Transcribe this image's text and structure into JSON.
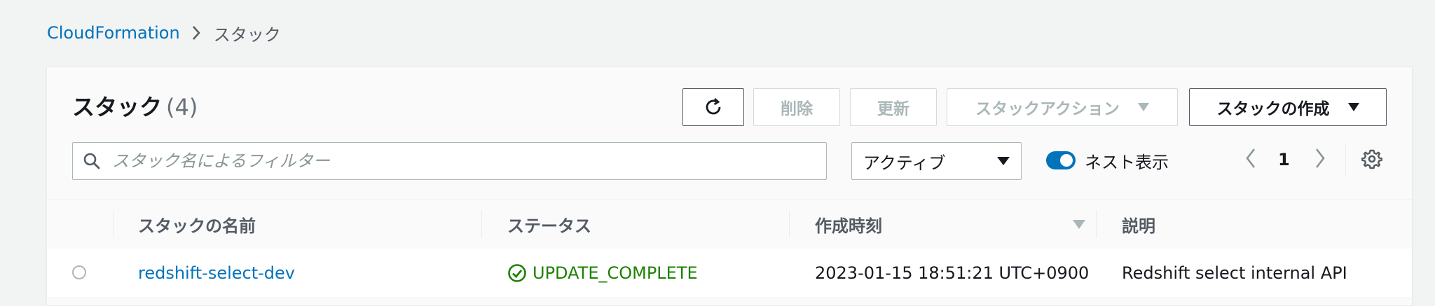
{
  "breadcrumb": {
    "root": "CloudFormation",
    "current": "スタック"
  },
  "panel": {
    "title": "スタック",
    "count": "(4)"
  },
  "toolbar": {
    "delete_label": "削除",
    "update_label": "更新",
    "stack_actions_label": "スタックアクション",
    "create_stack_label": "スタックの作成"
  },
  "filter": {
    "search_placeholder": "スタック名によるフィルター",
    "status_filter": "アクティブ",
    "nested_label": "ネスト表示",
    "nested_enabled": true
  },
  "pagination": {
    "current_page": "1"
  },
  "table": {
    "columns": [
      "スタックの名前",
      "ステータス",
      "作成時刻",
      "説明"
    ],
    "rows": [
      {
        "name": "redshift-select-dev",
        "status": "UPDATE_COMPLETE",
        "created": "2023-01-15 18:51:21 UTC+0900",
        "description": "Redshift select internal API"
      }
    ]
  },
  "colors": {
    "link": "#0073bb",
    "success": "#1d8102",
    "toggle_on": "#0073bb"
  }
}
